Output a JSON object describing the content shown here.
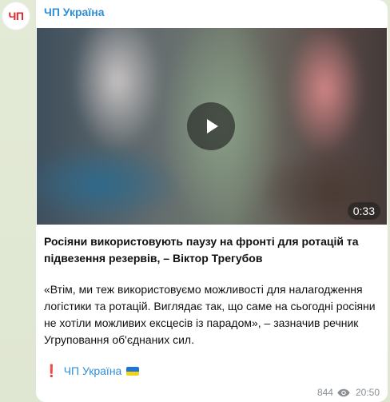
{
  "channel": {
    "avatar_text": "ЧП",
    "name": "ЧП Україна",
    "brand_color": "#e0262a",
    "link_color": "#2f8fd6"
  },
  "video": {
    "duration": "0:33",
    "play_icon": "play-icon"
  },
  "post": {
    "headline": "Росіяни використовують паузу на фронті для ротацій та підвезення резервів, – Віктор Трегубов",
    "quote": "«Втім, ми теж використовуємо можливості для налагодження логістики та ротацій. Виглядає так, що саме на сьогодні росіяни не хотіли можливих ексцесів із парадом», – зазначив речник Угруповання об'єднаних сил.",
    "signature_mark": "❗",
    "signature_text": "ЧП Україна",
    "flag_icon": "ukraine-flag-icon"
  },
  "meta": {
    "views": "844",
    "views_icon": "eye-icon",
    "time": "20:50"
  }
}
